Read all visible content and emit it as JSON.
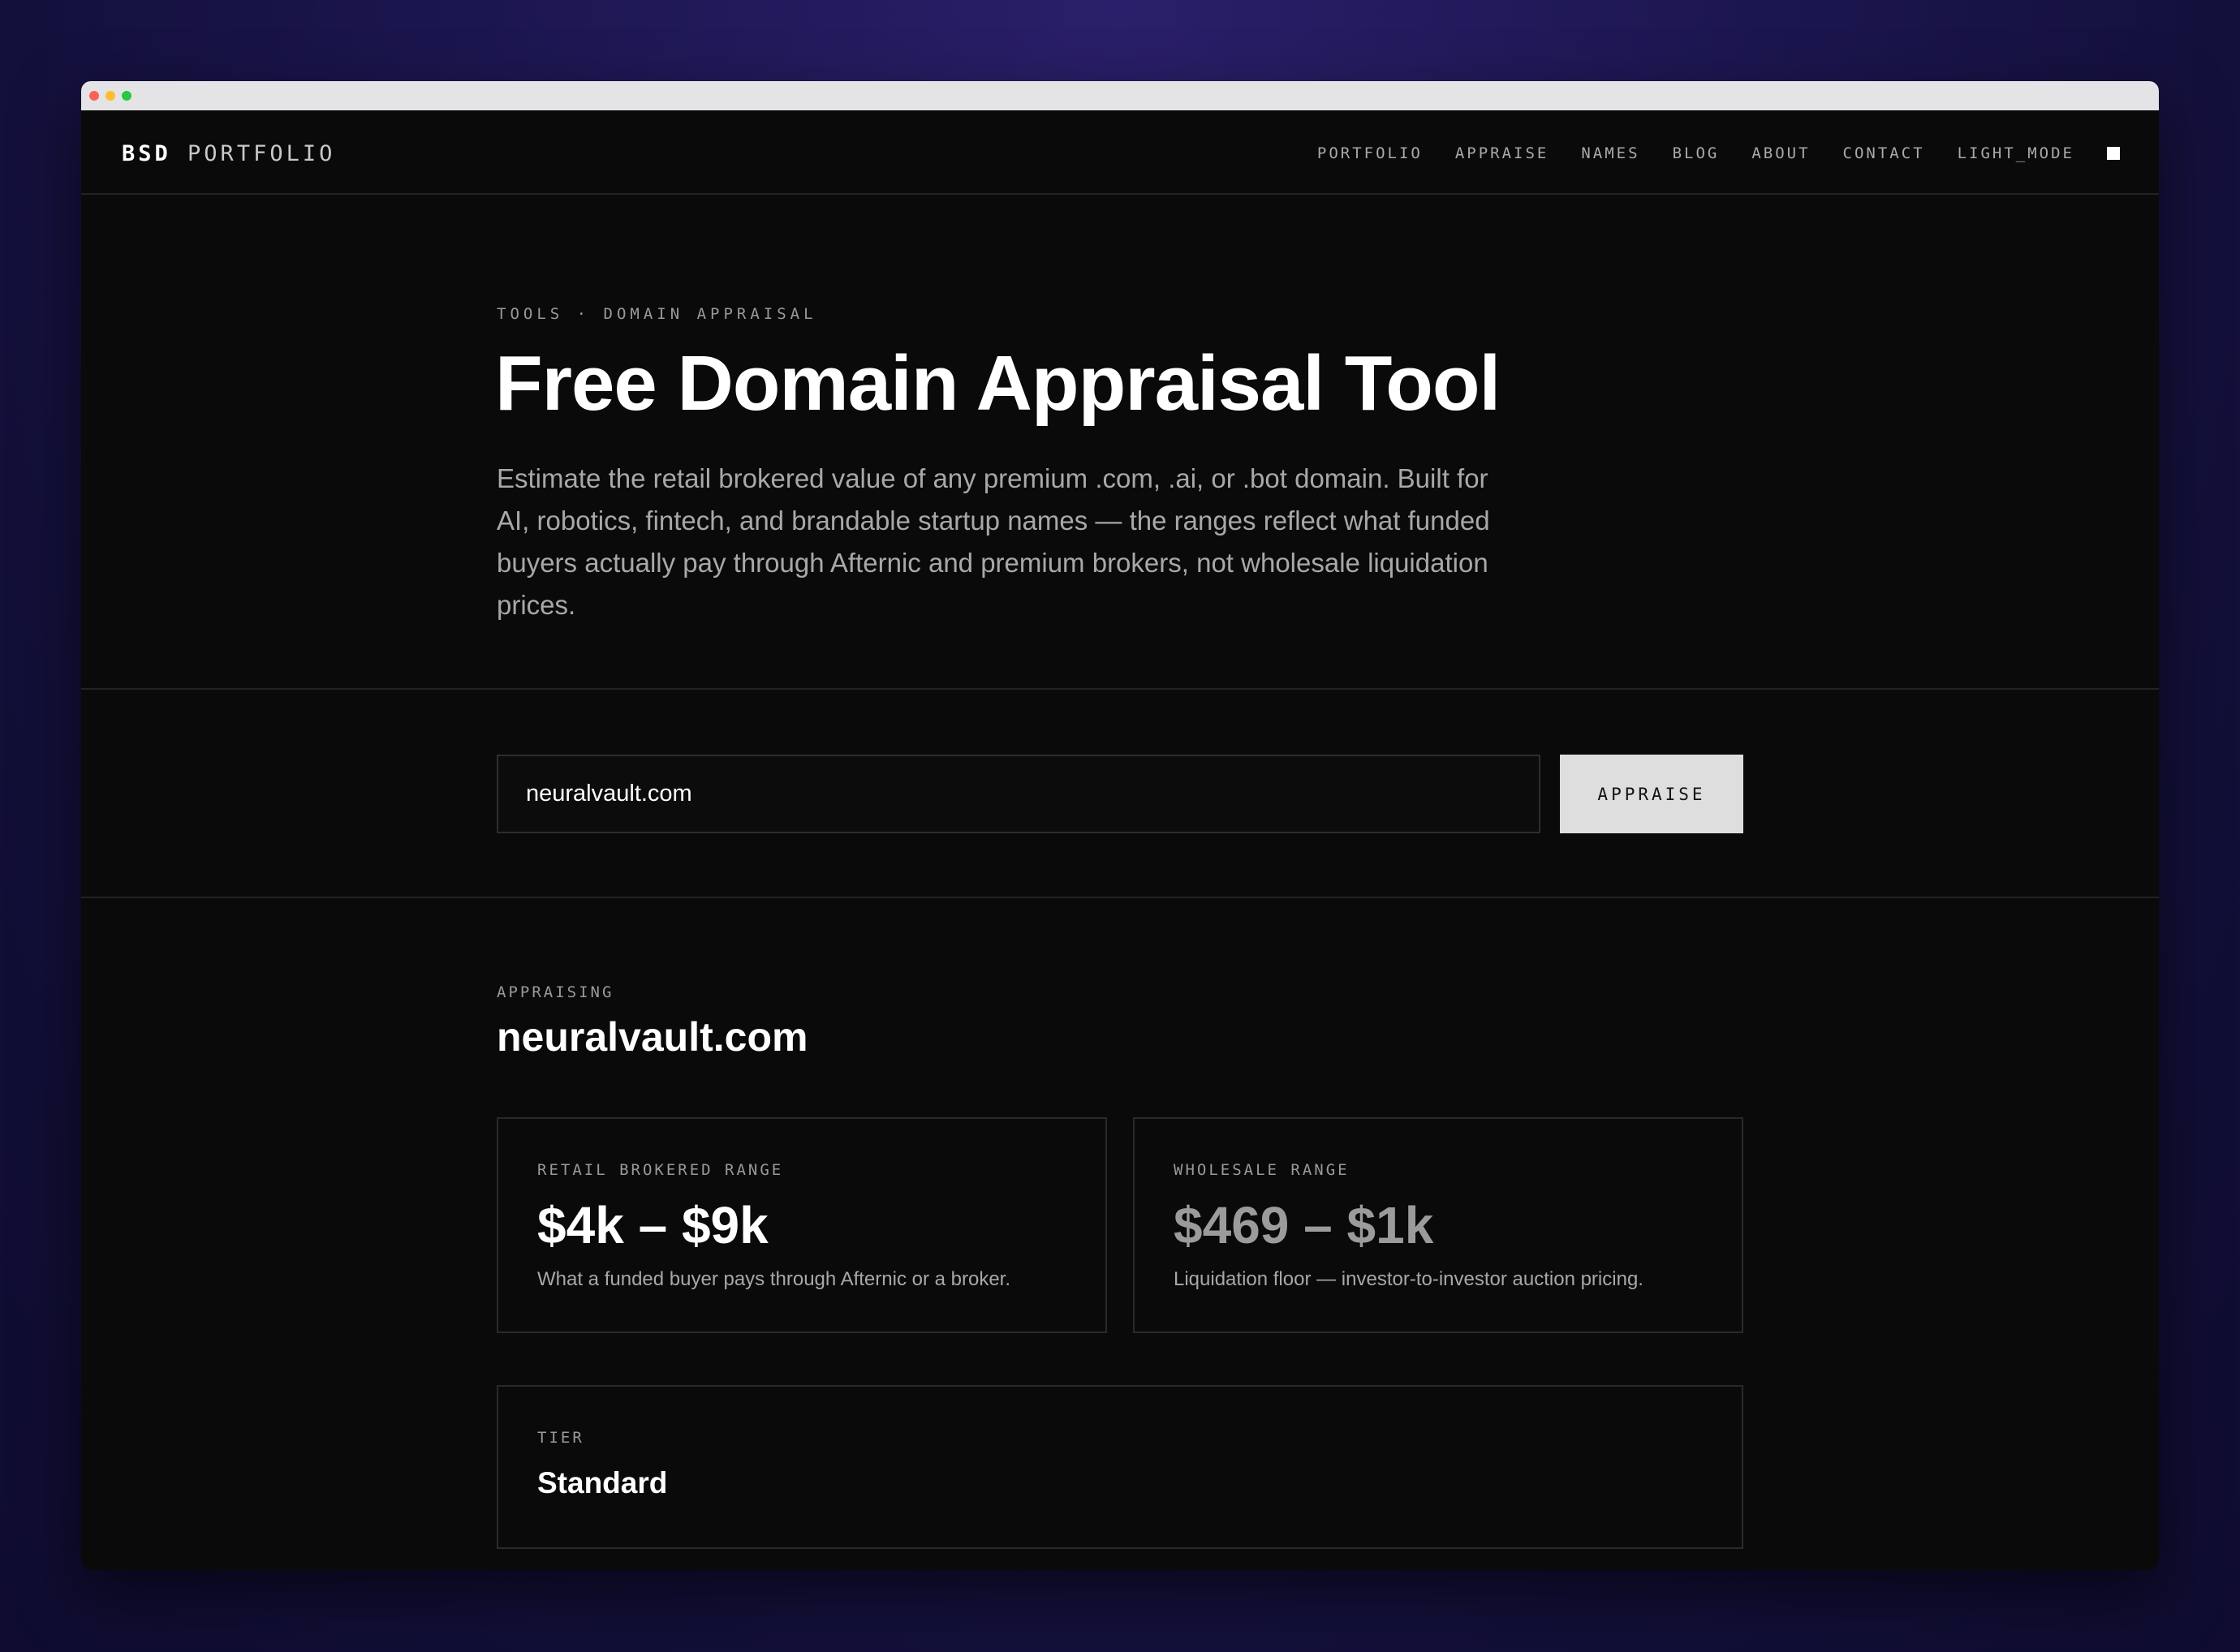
{
  "brand": {
    "part1": "BSD",
    "part2": "PORTFOLIO"
  },
  "nav": {
    "items": [
      "PORTFOLIO",
      "APPRAISE",
      "NAMES",
      "BLOG",
      "ABOUT",
      "CONTACT",
      "LIGHT_MODE"
    ],
    "toggle_icon": "square-icon"
  },
  "hero": {
    "breadcrumb": "TOOLS · DOMAIN APPRAISAL",
    "title": "Free Domain Appraisal Tool",
    "description": "Estimate the retail brokered value of any premium .com, .ai, or .bot domain. Built for AI, robotics, fintech, and brandable startup names — the ranges reflect what funded buyers actually pay through Afternic and premium brokers, not wholesale liquidation prices."
  },
  "form": {
    "input_value": "neuralvault.com",
    "button_label": "APPRAISE"
  },
  "results": {
    "label": "APPRAISING",
    "domain": "neuralvault.com",
    "retail": {
      "label": "RETAIL BROKERED RANGE",
      "value": "$4k – $9k",
      "sub": "What a funded buyer pays through Afternic or a broker."
    },
    "wholesale": {
      "label": "WHOLESALE RANGE",
      "value": "$469 – $1k",
      "sub": "Liquidation floor — investor-to-investor auction pricing."
    },
    "tier": {
      "label": "TIER",
      "value": "Standard"
    }
  },
  "colors": {
    "background": "#0a0a0a",
    "text": "#ffffff",
    "muted": "#9a9a9a",
    "button": "#dedede"
  }
}
